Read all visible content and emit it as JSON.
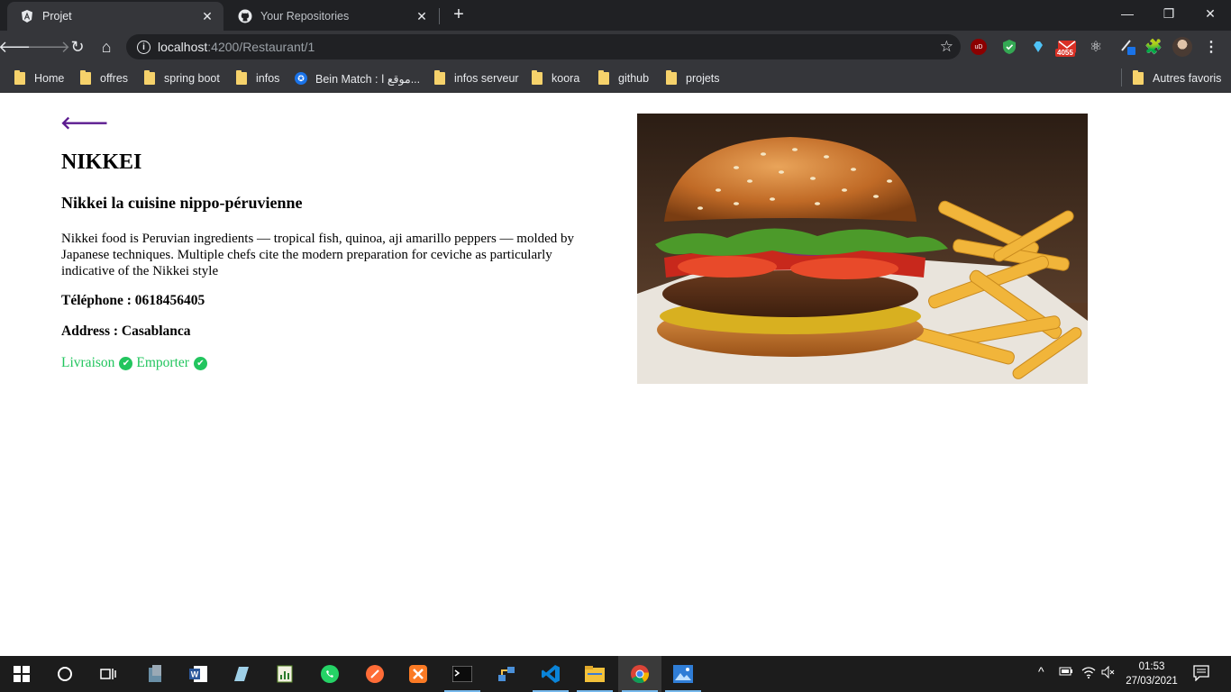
{
  "browser": {
    "tabs": [
      {
        "title": "Projet",
        "active": true
      },
      {
        "title": "Your Repositories",
        "active": false
      }
    ],
    "url": {
      "host": "localhost",
      "rest": ":4200/Restaurant/1"
    },
    "extension_badge": "4055",
    "bookmarks": [
      {
        "label": "Home",
        "icon": "folder-icon"
      },
      {
        "label": "offres",
        "icon": "folder-icon"
      },
      {
        "label": "spring boot",
        "icon": "folder-icon"
      },
      {
        "label": "infos",
        "icon": "folder-icon"
      },
      {
        "label": "Bein Match : موقع ا...",
        "icon": "site-icon"
      },
      {
        "label": "infos serveur",
        "icon": "folder-icon"
      },
      {
        "label": "koora",
        "icon": "folder-icon"
      },
      {
        "label": "github",
        "icon": "folder-icon"
      },
      {
        "label": "projets",
        "icon": "folder-icon"
      }
    ],
    "other_bookmarks": "Autres favoris"
  },
  "restaurant": {
    "name": "NIKKEI",
    "subtitle": "Nikkei la cuisine nippo-péruvienne",
    "description": "Nikkei food is Peruvian ingredients — tropical fish, quinoa, aji amarillo peppers — molded by Japanese techniques. Multiple chefs cite the modern preparation for ceviche as particularly indicative of the Nikkei style",
    "phone": "Téléphone : 0618456405",
    "address": "Address : Casablanca",
    "services": [
      {
        "label": "Livraison",
        "available": true
      },
      {
        "label": "Emporter",
        "available": true
      }
    ],
    "image_subject": "burger with fries"
  },
  "colors": {
    "back_arrow": "#5b1a8f",
    "service_green": "#22c55e"
  },
  "taskbar": {
    "time": "01:53",
    "date": "27/03/2021"
  }
}
